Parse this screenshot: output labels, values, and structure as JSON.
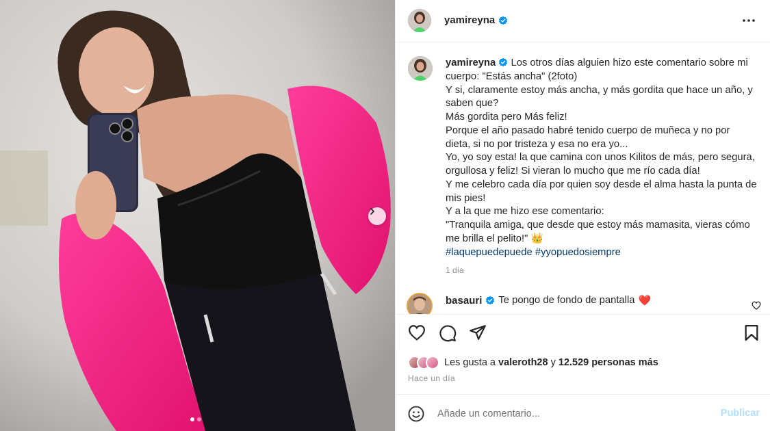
{
  "post": {
    "username": "yamireyna",
    "caption_paragraphs": [
      "Los otros días alguien hizo este comentario sobre mi cuerpo: \"Estás ancha\" (2foto)",
      "Y si, claramente estoy más ancha, y más gordita que hace un año, y saben que?",
      "Más gordita pero Más feliz!",
      "Porque el año pasado habré tenido cuerpo de muñeca y no por dieta, si no por tristeza y esa no era yo...",
      "Yo, yo soy esta! la que camina con unos Kilitos de más, pero segura, orgullosa y feliz! Si vieran lo mucho que me río cada día!",
      "Y me celebro cada día por quien soy desde el alma hasta la punta de mis pies!",
      "Y a la que me hizo ese comentario:",
      "\"Tranquila amiga, que desde que estoy más mamasita, vieras cómo me brilla el pelito!\" 👑"
    ],
    "hashtags": [
      "#laquepuedepuede",
      "#yyopuedosiempre"
    ],
    "time_short": "1 día"
  },
  "comment": {
    "username": "basauri",
    "text": "Te pongo de fondo de pantalla",
    "emoji": "❤️"
  },
  "likes": {
    "prefix": "Les gusta a",
    "user": "valeroth28",
    "connector": "y",
    "count_text": "12.529 personas más"
  },
  "posted": "Hace un día",
  "add_comment": {
    "placeholder": "Añade un comentario...",
    "publish_label": "Publicar"
  },
  "media": {
    "slide_count": 2,
    "active_slide": 1
  },
  "colors": {
    "verified": "#0095f6",
    "hashtag": "#00376b",
    "publish_disabled": "#b2dffc",
    "heart_red": "#ed4956"
  }
}
